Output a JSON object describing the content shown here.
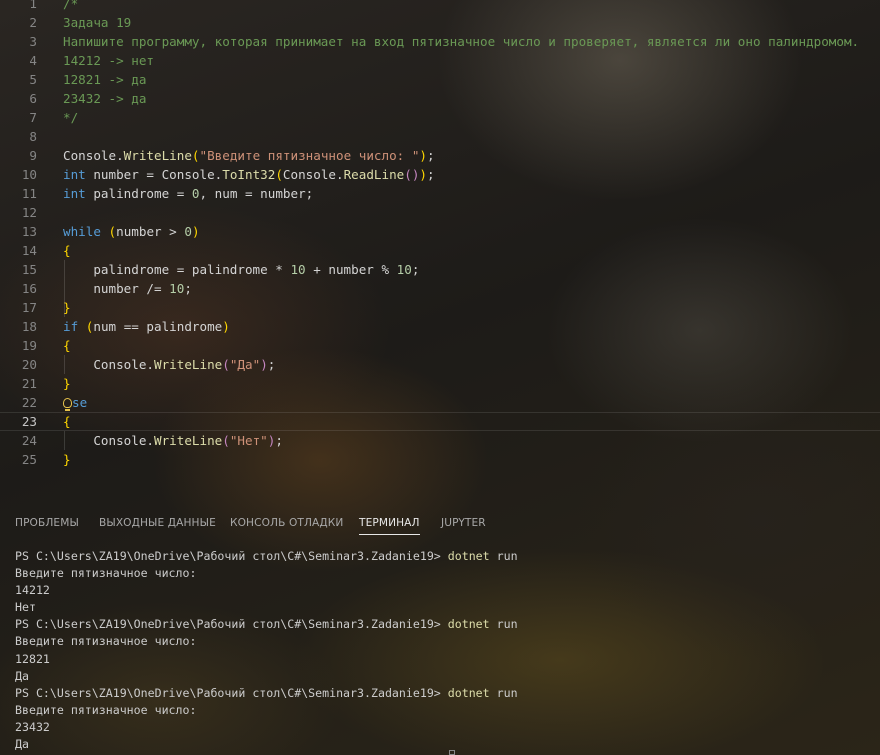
{
  "editor": {
    "active_line": 23,
    "lines": [
      {
        "n": "1",
        "tokens": [
          {
            "t": "/*",
            "c": "comment"
          }
        ]
      },
      {
        "n": "2",
        "tokens": [
          {
            "t": "Задача 19",
            "c": "comment"
          }
        ]
      },
      {
        "n": "3",
        "tokens": [
          {
            "t": "Напишите программу, которая принимает на вход пятизначное число и проверяет, является ли оно палиндромом.",
            "c": "comment"
          }
        ]
      },
      {
        "n": "4",
        "tokens": [
          {
            "t": "14212 -> нет",
            "c": "comment"
          }
        ]
      },
      {
        "n": "5",
        "tokens": [
          {
            "t": "12821 -> да",
            "c": "comment"
          }
        ]
      },
      {
        "n": "6",
        "tokens": [
          {
            "t": "23432 -> да",
            "c": "comment"
          }
        ]
      },
      {
        "n": "7",
        "tokens": [
          {
            "t": "*/",
            "c": "comment"
          }
        ]
      },
      {
        "n": "8",
        "tokens": []
      },
      {
        "n": "9",
        "tokens": [
          {
            "t": "Console",
            "c": "plain"
          },
          {
            "t": ".",
            "c": "plain"
          },
          {
            "t": "WriteLine",
            "c": "fn"
          },
          {
            "t": "(",
            "c": "brace"
          },
          {
            "t": "\"Введите пятизначное число: \"",
            "c": "str"
          },
          {
            "t": ")",
            "c": "brace"
          },
          {
            "t": ";",
            "c": "plain"
          }
        ]
      },
      {
        "n": "10",
        "tokens": [
          {
            "t": "int",
            "c": "kw"
          },
          {
            "t": " number = Console.",
            "c": "plain"
          },
          {
            "t": "ToInt32",
            "c": "fn"
          },
          {
            "t": "(",
            "c": "brace"
          },
          {
            "t": "Console.",
            "c": "plain"
          },
          {
            "t": "ReadLine",
            "c": "fn"
          },
          {
            "t": "()",
            "c": "ctrl"
          },
          {
            "t": ")",
            "c": "brace"
          },
          {
            "t": ";",
            "c": "plain"
          }
        ]
      },
      {
        "n": "11",
        "tokens": [
          {
            "t": "int",
            "c": "kw"
          },
          {
            "t": " palindrome = ",
            "c": "plain"
          },
          {
            "t": "0",
            "c": "num"
          },
          {
            "t": ", num = number;",
            "c": "plain"
          }
        ]
      },
      {
        "n": "12",
        "tokens": []
      },
      {
        "n": "13",
        "tokens": [
          {
            "t": "while",
            "c": "kw"
          },
          {
            "t": " ",
            "c": "plain"
          },
          {
            "t": "(",
            "c": "brace"
          },
          {
            "t": "number > ",
            "c": "plain"
          },
          {
            "t": "0",
            "c": "num"
          },
          {
            "t": ")",
            "c": "brace"
          }
        ]
      },
      {
        "n": "14",
        "tokens": [
          {
            "t": "{",
            "c": "brace"
          }
        ]
      },
      {
        "n": "15",
        "tokens": [
          {
            "t": "    palindrome = palindrome * ",
            "c": "plain"
          },
          {
            "t": "10",
            "c": "num"
          },
          {
            "t": " + number % ",
            "c": "plain"
          },
          {
            "t": "10",
            "c": "num"
          },
          {
            "t": ";",
            "c": "plain"
          }
        ]
      },
      {
        "n": "16",
        "tokens": [
          {
            "t": "    number /= ",
            "c": "plain"
          },
          {
            "t": "10",
            "c": "num"
          },
          {
            "t": ";",
            "c": "plain"
          }
        ]
      },
      {
        "n": "17",
        "tokens": [
          {
            "t": "}",
            "c": "brace"
          }
        ]
      },
      {
        "n": "18",
        "tokens": [
          {
            "t": "if",
            "c": "kw"
          },
          {
            "t": " ",
            "c": "plain"
          },
          {
            "t": "(",
            "c": "brace"
          },
          {
            "t": "num == palindrome",
            "c": "plain"
          },
          {
            "t": ")",
            "c": "brace"
          }
        ]
      },
      {
        "n": "19",
        "tokens": [
          {
            "t": "{",
            "c": "brace"
          }
        ]
      },
      {
        "n": "20",
        "tokens": [
          {
            "t": "    Console.",
            "c": "plain"
          },
          {
            "t": "WriteLine",
            "c": "fn"
          },
          {
            "t": "(",
            "c": "ctrl"
          },
          {
            "t": "\"Да\"",
            "c": "str"
          },
          {
            "t": ")",
            "c": "ctrl"
          },
          {
            "t": ";",
            "c": "plain"
          }
        ]
      },
      {
        "n": "21",
        "tokens": [
          {
            "t": "}",
            "c": "brace"
          }
        ]
      },
      {
        "n": "22",
        "tokens": [
          {
            "t": "se",
            "c": "kw"
          }
        ],
        "bulb": true
      },
      {
        "n": "23",
        "tokens": [
          {
            "t": "{",
            "c": "brace"
          }
        ]
      },
      {
        "n": "24",
        "tokens": [
          {
            "t": "    Console.",
            "c": "plain"
          },
          {
            "t": "WriteLine",
            "c": "fn"
          },
          {
            "t": "(",
            "c": "ctrl"
          },
          {
            "t": "\"Нет\"",
            "c": "str"
          },
          {
            "t": ")",
            "c": "ctrl"
          },
          {
            "t": ";",
            "c": "plain"
          }
        ]
      },
      {
        "n": "25",
        "tokens": [
          {
            "t": "}",
            "c": "brace"
          }
        ]
      }
    ]
  },
  "panel": {
    "tabs": [
      {
        "label": "ПРОБЛЕМЫ",
        "name": "tab-problems"
      },
      {
        "label": "ВЫХОДНЫЕ ДАННЫЕ",
        "name": "tab-output"
      },
      {
        "label": "КОНСОЛЬ ОТЛАДКИ",
        "name": "tab-debug-console"
      },
      {
        "label": "ТЕРМИНАЛ",
        "name": "tab-terminal",
        "active": true
      },
      {
        "label": "JUPYTER",
        "name": "tab-jupyter"
      }
    ],
    "terminal": [
      {
        "prompt": "PS C:\\Users\\ZA19\\OneDrive\\Рабочий стол\\C#\\Seminar3.Zadanie19> ",
        "cmd": "dotnet",
        "args": " run"
      },
      {
        "text": "Введите пятизначное число:"
      },
      {
        "text": "14212"
      },
      {
        "text": "Нет"
      },
      {
        "prompt": "PS C:\\Users\\ZA19\\OneDrive\\Рабочий стол\\C#\\Seminar3.Zadanie19> ",
        "cmd": "dotnet",
        "args": " run"
      },
      {
        "text": "Введите пятизначное число:"
      },
      {
        "text": "12821"
      },
      {
        "text": "Да"
      },
      {
        "prompt": "PS C:\\Users\\ZA19\\OneDrive\\Рабочий стол\\C#\\Seminar3.Zadanie19> ",
        "cmd": "dotnet",
        "args": " run"
      },
      {
        "text": "Введите пятизначное число:"
      },
      {
        "text": "23432"
      },
      {
        "text": "Да"
      }
    ]
  }
}
